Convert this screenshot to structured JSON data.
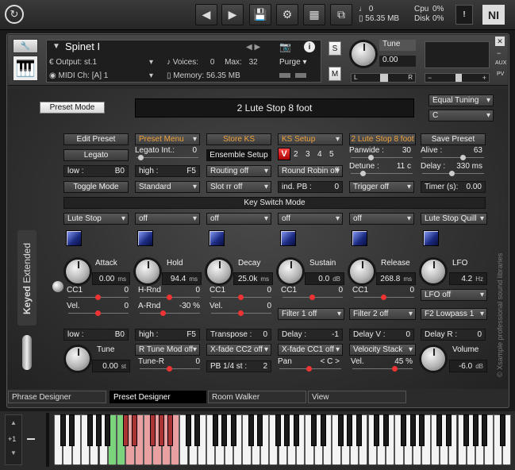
{
  "topbar": {
    "cpu_label": "Cpu",
    "cpu_value": "0%",
    "disk_label": "Disk",
    "disk_value": "0%",
    "voices_count": "0",
    "memory": "56.35 MB",
    "ni_label": "NI"
  },
  "instrument": {
    "name": "Spinet I",
    "output_label": "Output:",
    "output_value": "st.1",
    "voices_label": "Voices:",
    "voices_value": "0",
    "max_label": "Max:",
    "max_value": "32",
    "midi_label": "MIDI Ch:",
    "midi_value": "[A]  1",
    "memory_label": "Memory:",
    "memory_value": "56.35 MB",
    "purge": "Purge",
    "s": "S",
    "m": "M",
    "tune_label": "Tune",
    "tune_value": "0.00",
    "l": "L",
    "r": "R",
    "aux": "AUX",
    "pv": "PV"
  },
  "panel": {
    "preset_mode": "Preset Mode",
    "display": "2 Lute Stop 8 foot",
    "tuning": "Equal Tuning",
    "key": "C",
    "row1": [
      "Edit Preset",
      "Preset Menu",
      "Store KS",
      "KS Setup",
      "2 Lute Stop 8 foot",
      "Save Preset"
    ],
    "legato": "Legato",
    "legato_int_label": "Legato Int.:",
    "legato_int_value": "0",
    "ensemble": "Ensemble Setup",
    "ks_numbers": [
      "2",
      "3",
      "4",
      "5"
    ],
    "ks_v": "V",
    "panwide_label": "Panwide :",
    "panwide_value": "30",
    "alive_label": "Alive :",
    "alive_value": "63",
    "low_label": "low :",
    "low_value": "B0",
    "high_label": "high :",
    "high_value": "F5",
    "routing": "Routing off",
    "round_robin": "Round Robin off",
    "detune_label": "Detune :",
    "detune_value": "11 c",
    "delay_label": "Delay :",
    "delay_value": "330 ms",
    "toggle": "Toggle Mode",
    "standard": "Standard",
    "slot_rr": "Slot rr off",
    "ind_pb_label": "ind. PB :",
    "ind_pb_value": "0",
    "trigger": "Trigger off",
    "timer_label": "Timer (s):",
    "timer_value": "0.00",
    "ks_mode": "Key Switch Mode",
    "ks_menus": [
      "Lute Stop",
      "off",
      "off",
      "off",
      "off",
      "Lute Stop Quill"
    ],
    "env": [
      {
        "label": "Attack",
        "value": "0.00",
        "unit": "ms"
      },
      {
        "label": "Hold",
        "value": "94.4",
        "unit": "ms"
      },
      {
        "label": "Decay",
        "value": "25.0k",
        "unit": "ms"
      },
      {
        "label": "Sustain",
        "value": "0.0",
        "unit": "dB"
      },
      {
        "label": "Release",
        "value": "268.8",
        "unit": "ms"
      },
      {
        "label": "LFO",
        "value": "4.2",
        "unit": "Hz"
      }
    ],
    "cc1_label": "CC1",
    "cc1_values": [
      "0",
      "0",
      "0",
      "0"
    ],
    "vel_label": "Vel.",
    "vel_values": [
      "0",
      "0"
    ],
    "hrnd_label": "H-Rnd",
    "hrnd_value": "0",
    "arnd_label": "A-Rnd",
    "arnd_value": "-30 %",
    "filter1": "Filter 1 off",
    "filter2": "Filter 2 off",
    "lfo_off": "LFO off",
    "f2_lowpass": "F2 Lowpass 1",
    "low2_label": "low :",
    "low2_value": "B0",
    "high2_label": "high :",
    "high2_value": "F5",
    "transpose_label": "Transpose :",
    "transpose_value": "0",
    "delay2_label": "Delay :",
    "delay2_value": "-1",
    "delay_v_label": "Delay V :",
    "delay_v_value": "0",
    "delay_r_label": "Delay R :",
    "delay_r_value": "0",
    "tune_label": "Tune",
    "tune_value": "0.00",
    "tune_unit": "st",
    "r_tune": "R Tune Mod off",
    "xfade_cc2": "X-fade CC2 off",
    "xfade_cc1": "X-fade CC1 off",
    "velocity_stack": "Velocity Stack",
    "volume_label": "Volume",
    "volume_value": "-6.0",
    "volume_unit": "dB",
    "tune_r_label": "Tune-R",
    "tune_r_value": "0",
    "pb_label": "PB 1/4 st :",
    "pb_value": "2",
    "pan_label": "Pan",
    "pan_value": "< C >",
    "vel2_label": "Vel.",
    "vel2_value": "45 %",
    "side_keyed": "Keyed",
    "side_extended": "Extended",
    "copyright": "© Xsample professional sound libraries"
  },
  "tabs": [
    "Phrase Designer",
    "Preset Designer",
    "Room Walker",
    "View"
  ],
  "keyboard": {
    "octave": "+1"
  }
}
